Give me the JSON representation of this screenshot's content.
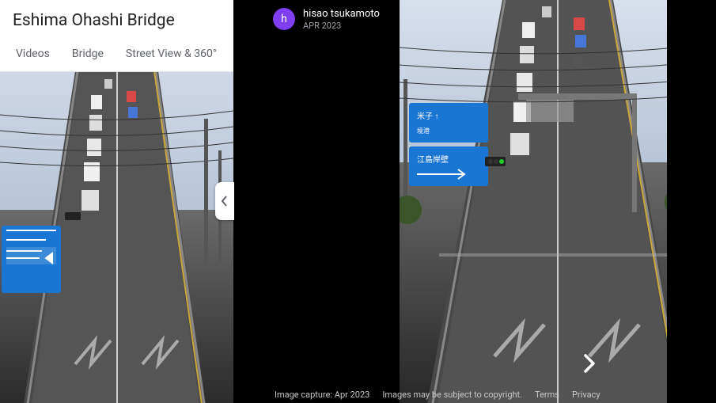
{
  "left": {
    "title": "Eshima Ohashi Bridge",
    "tabs": [
      "Videos",
      "Bridge",
      "Street View & 360°"
    ]
  },
  "attribution": {
    "avatar_initial": "h",
    "author": "hisao tsukamoto",
    "date": "APR 2023"
  },
  "footer": {
    "capture": "Image capture: Apr 2023",
    "copyright": "Images may be subject to copyright.",
    "terms": "Terms",
    "privacy": "Privacy"
  },
  "colors": {
    "avatar": "#7e3ff2",
    "sign_blue": "#1976d2"
  }
}
